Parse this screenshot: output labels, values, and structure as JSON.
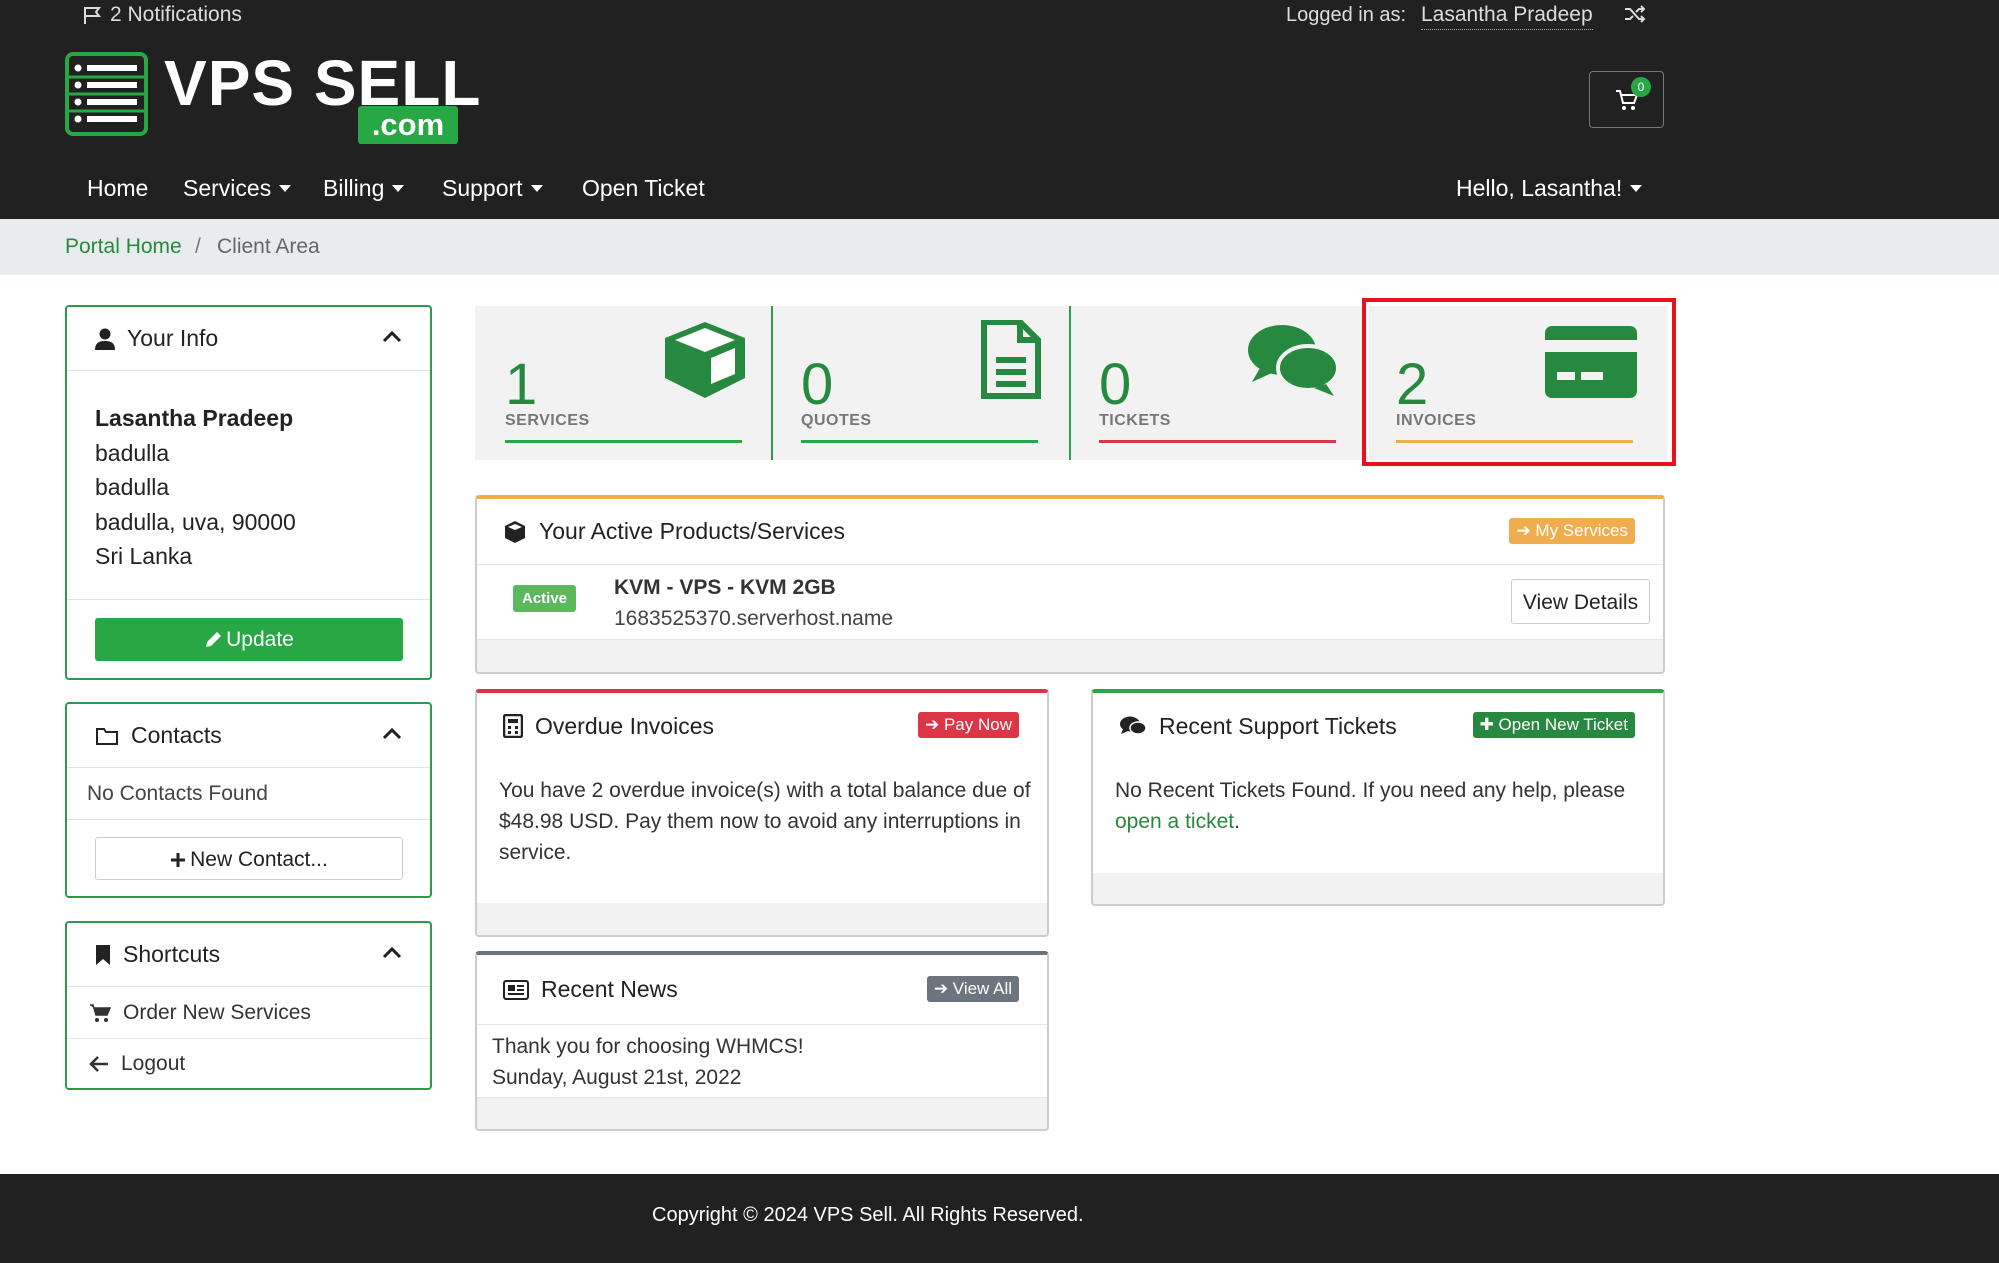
{
  "header": {
    "notifications": "2 Notifications",
    "logged_in_label": "Logged in as:",
    "user_name": "Lasantha Pradeep",
    "cart_count": "0",
    "logo_text": "VPS SELL",
    "logo_suffix": ".com"
  },
  "nav": {
    "home": "Home",
    "services": "Services",
    "billing": "Billing",
    "support": "Support",
    "open_ticket": "Open Ticket",
    "greeting": "Hello, Lasantha!"
  },
  "breadcrumb": {
    "home": "Portal Home",
    "sep": "/",
    "current": "Client Area"
  },
  "your_info": {
    "title": "Your Info",
    "name": "Lasantha Pradeep",
    "line1": "badulla",
    "line2": "badulla",
    "line3": "badulla, uva, 90000",
    "country": "Sri Lanka",
    "update_label": "Update"
  },
  "contacts": {
    "title": "Contacts",
    "empty": "No Contacts Found",
    "new_label": "New Contact..."
  },
  "shortcuts": {
    "title": "Shortcuts",
    "order": "Order New Services",
    "logout": "Logout"
  },
  "stats": {
    "services": {
      "count": "1",
      "label": "SERVICES"
    },
    "quotes": {
      "count": "0",
      "label": "QUOTES"
    },
    "tickets": {
      "count": "0",
      "label": "TICKETS"
    },
    "invoices": {
      "count": "2",
      "label": "INVOICES"
    }
  },
  "products": {
    "title": "Your Active Products/Services",
    "button": "My Services",
    "status": "Active",
    "name": "KVM - VPS - KVM 2GB",
    "host": "1683525370.serverhost.name",
    "details": "View Details"
  },
  "overdue": {
    "title": "Overdue Invoices",
    "button": "Pay Now",
    "text": "You have 2 overdue invoice(s) with a total balance due of $48.98 USD. Pay them now to avoid any interruptions in service."
  },
  "tickets_panel": {
    "title": "Recent Support Tickets",
    "button": "Open New Ticket",
    "text": "No Recent Tickets Found. If you need any help, please",
    "link": "open a ticket",
    "end": "."
  },
  "news": {
    "title": "Recent News",
    "button": "View All",
    "headline": "Thank you for choosing WHMCS!",
    "date": "Sunday, August 21st, 2022"
  },
  "footer": {
    "copyright": "Copyright © 2024 VPS Sell. All Rights Reserved."
  },
  "colors": {
    "green": "#27a844",
    "orange": "#f0ad4e",
    "red": "#dc3545",
    "highlight": "#e8101c"
  }
}
